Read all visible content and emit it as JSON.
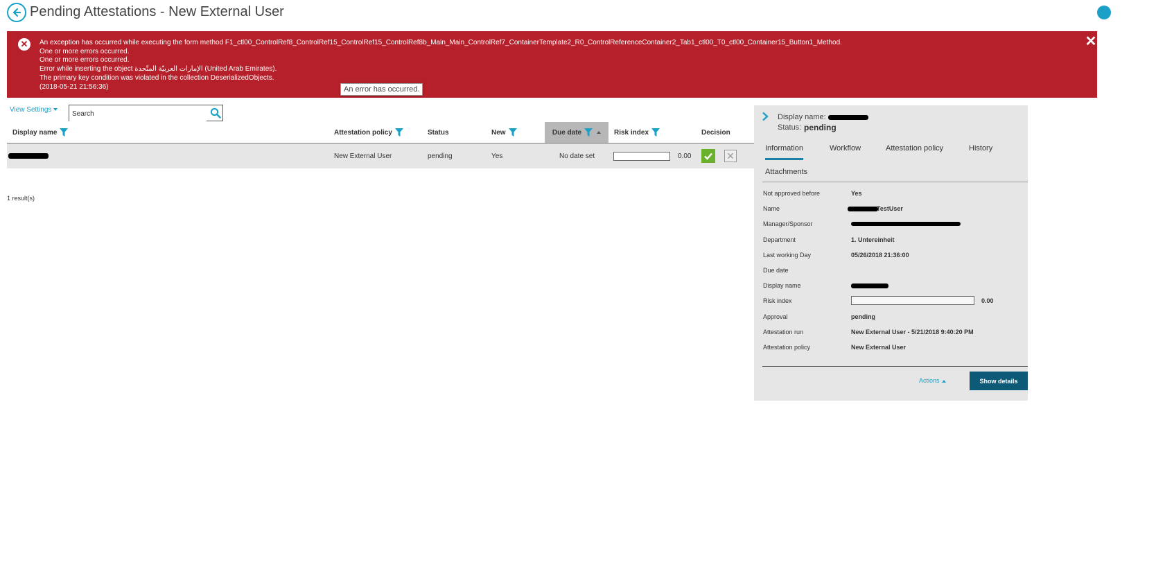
{
  "header": {
    "title": "Pending Attestations - New External User"
  },
  "error": {
    "lines": [
      "An exception has occurred while executing the form method F1_ctl00_ControlRef8_ControlRef15_ControlRef15_ControlRef8b_Main_Main_ControlRef7_ContainerTemplate2_R0_ControlReferenceContainer2_Tab1_ctl00_T0_ctl00_Container15_Button1_Method.",
      "One or more errors occurred.",
      "One or more errors occurred.",
      "Error while inserting the object الإمارات العربيّة المتّحدة (United Arab Emirates).",
      "The primary key condition was violated in the collection DeserializedObjects.",
      "(2018-05-21 21:56:36)"
    ],
    "tooltip": "An error has occurred.",
    "close_glyph": "✕",
    "color": "#b5202a"
  },
  "toolbar": {
    "view_settings": "View Settings",
    "search_placeholder": "Search"
  },
  "table": {
    "columns": {
      "display_name": "Display name",
      "attestation_policy": "Attestation policy",
      "status": "Status",
      "new": "New",
      "due_date": "Due date",
      "risk_index": "Risk index",
      "decision": "Decision"
    },
    "rows": [
      {
        "attestation_policy": "New External User",
        "status": "pending",
        "new": "Yes",
        "due_date": "No date set",
        "risk_index": "0.00"
      }
    ],
    "results": "1 result(s)"
  },
  "panel": {
    "display_name_label": "Display name:",
    "status_label": "Status:",
    "status_value": "pending",
    "tabs": [
      "Information",
      "Workflow",
      "Attestation policy",
      "History",
      "Attachments"
    ],
    "info": {
      "not_approved_label": "Not approved before",
      "not_approved_value": "Yes",
      "name_label": "Name",
      "name_value": "TestUser",
      "manager_label": "Manager/Sponsor",
      "department_label": "Department",
      "department_value": "1. Untereinheit",
      "last_working_day_label": "Last working Day",
      "last_working_day_value": "05/26/2018 21:36:00",
      "due_date_label": "Due date",
      "display_name_label": "Display name",
      "risk_index_label": "Risk index",
      "risk_index_value": "0.00",
      "approval_label": "Approval",
      "approval_value": "pending",
      "attestation_run_label": "Attestation run",
      "attestation_run_value": "New External User - 5/21/2018 9:40:20 PM",
      "attestation_policy_label": "Attestation policy",
      "attestation_policy_value": "New External User"
    },
    "actions": "Actions",
    "show_details": "Show details"
  },
  "colors": {
    "accent": "#1ba1c7",
    "primary_button": "#0d5a78",
    "approve": "#6ab22e"
  }
}
